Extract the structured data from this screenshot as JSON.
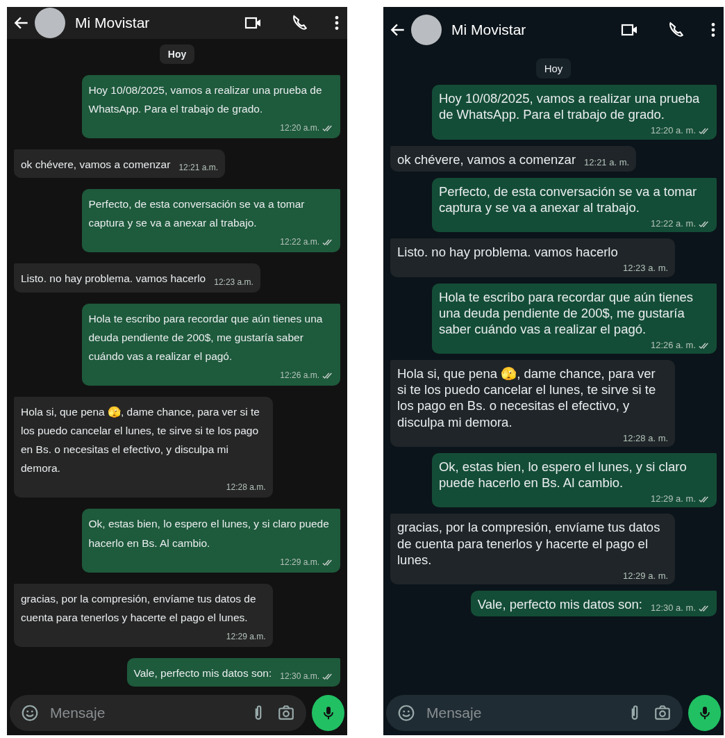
{
  "screens": [
    {
      "header": {
        "title": "Mi Movistar"
      },
      "date_label": "Hoy",
      "composer": {
        "placeholder": "Mensaje"
      },
      "messages": [
        {
          "kind": "sent",
          "text": "Hoy 10/08/2025, vamos a realizar una prueba de WhatsApp. Para el trabajo de grado.",
          "time": "12:20 a.m.",
          "read": false
        },
        {
          "kind": "received",
          "text": "ok chévere, vamos a comenzar",
          "time": "12:21 a.m."
        },
        {
          "kind": "sent",
          "text": "Perfecto, de esta conversación se va a tomar captura y se va a anexar al trabajo.",
          "time": "12:22 a.m.",
          "read": false
        },
        {
          "kind": "received",
          "text": "Listo. no hay problema. vamos hacerlo",
          "time": "12:23 a.m."
        },
        {
          "kind": "sent",
          "text": "Hola te escribo para recordar que aún tienes una deuda pendiente de 200$, me gustaría saber cuándo vas a realizar el pagó.",
          "time": "12:26 a.m.",
          "read": false
        },
        {
          "kind": "received",
          "text": "Hola si, que pena 🫣, dame chance, para ver si te los puedo cancelar el lunes, te sirve si te los pago en Bs. o necesitas el efectivo, y disculpa mi demora.",
          "time": "12:28 a.m."
        },
        {
          "kind": "sent",
          "text": "Ok, estas bien, lo espero el lunes, y si claro puede hacerlo en Bs. Al cambio.",
          "time": "12:29 a.m.",
          "read": false
        },
        {
          "kind": "received",
          "text": "gracias, por la compresión, envíame tus datos de cuenta para tenerlos y hacerte el pago el lunes.",
          "time": "12:29 a.m."
        },
        {
          "kind": "sent",
          "text": "Vale, perfecto mis datos son:",
          "time": "12:30 a.m.",
          "read": false
        }
      ]
    },
    {
      "header": {
        "title": "Mi Movistar"
      },
      "date_label": "Hoy",
      "composer": {
        "placeholder": "Mensaje"
      },
      "messages": [
        {
          "kind": "sent",
          "text": "Hoy 10/08/2025, vamos a realizar una prueba de WhatsApp. Para el trabajo de grado.",
          "time": "12:20 a. m.",
          "read": false
        },
        {
          "kind": "received",
          "text": "ok chévere, vamos a comenzar",
          "time": "12:21 a. m."
        },
        {
          "kind": "sent",
          "text": "Perfecto, de esta conversación se va a tomar captura y se va a anexar al trabajo.",
          "time": "12:22 a. m.",
          "read": false
        },
        {
          "kind": "received",
          "text": "Listo. no hay problema. vamos hacerlo",
          "time": "12:23 a. m."
        },
        {
          "kind": "sent",
          "text": "Hola te escribo para recordar que aún tienes una deuda pendiente de 200$, me gustaría saber cuándo vas a realizar el pagó.",
          "time": "12:26 a. m.",
          "read": false
        },
        {
          "kind": "received",
          "text": "Hola si, que pena 🫣, dame chance, para ver si te los puedo cancelar el lunes, te sirve si te los pago en Bs. o necesitas el efectivo, y disculpa mi demora.",
          "time": "12:28 a. m."
        },
        {
          "kind": "sent",
          "text": "Ok, estas bien, lo espero el lunes, y si claro puede hacerlo en Bs. Al cambio.",
          "time": "12:29 a. m.",
          "read": false
        },
        {
          "kind": "received",
          "text": "gracias, por la compresión, envíame tus datos de cuenta para tenerlos y hacerte el pago el lunes.",
          "time": "12:29 a. m."
        },
        {
          "kind": "sent",
          "text": "Vale, perfecto mis datos son:",
          "time": "12:30 a. m.",
          "read": false
        }
      ]
    }
  ]
}
